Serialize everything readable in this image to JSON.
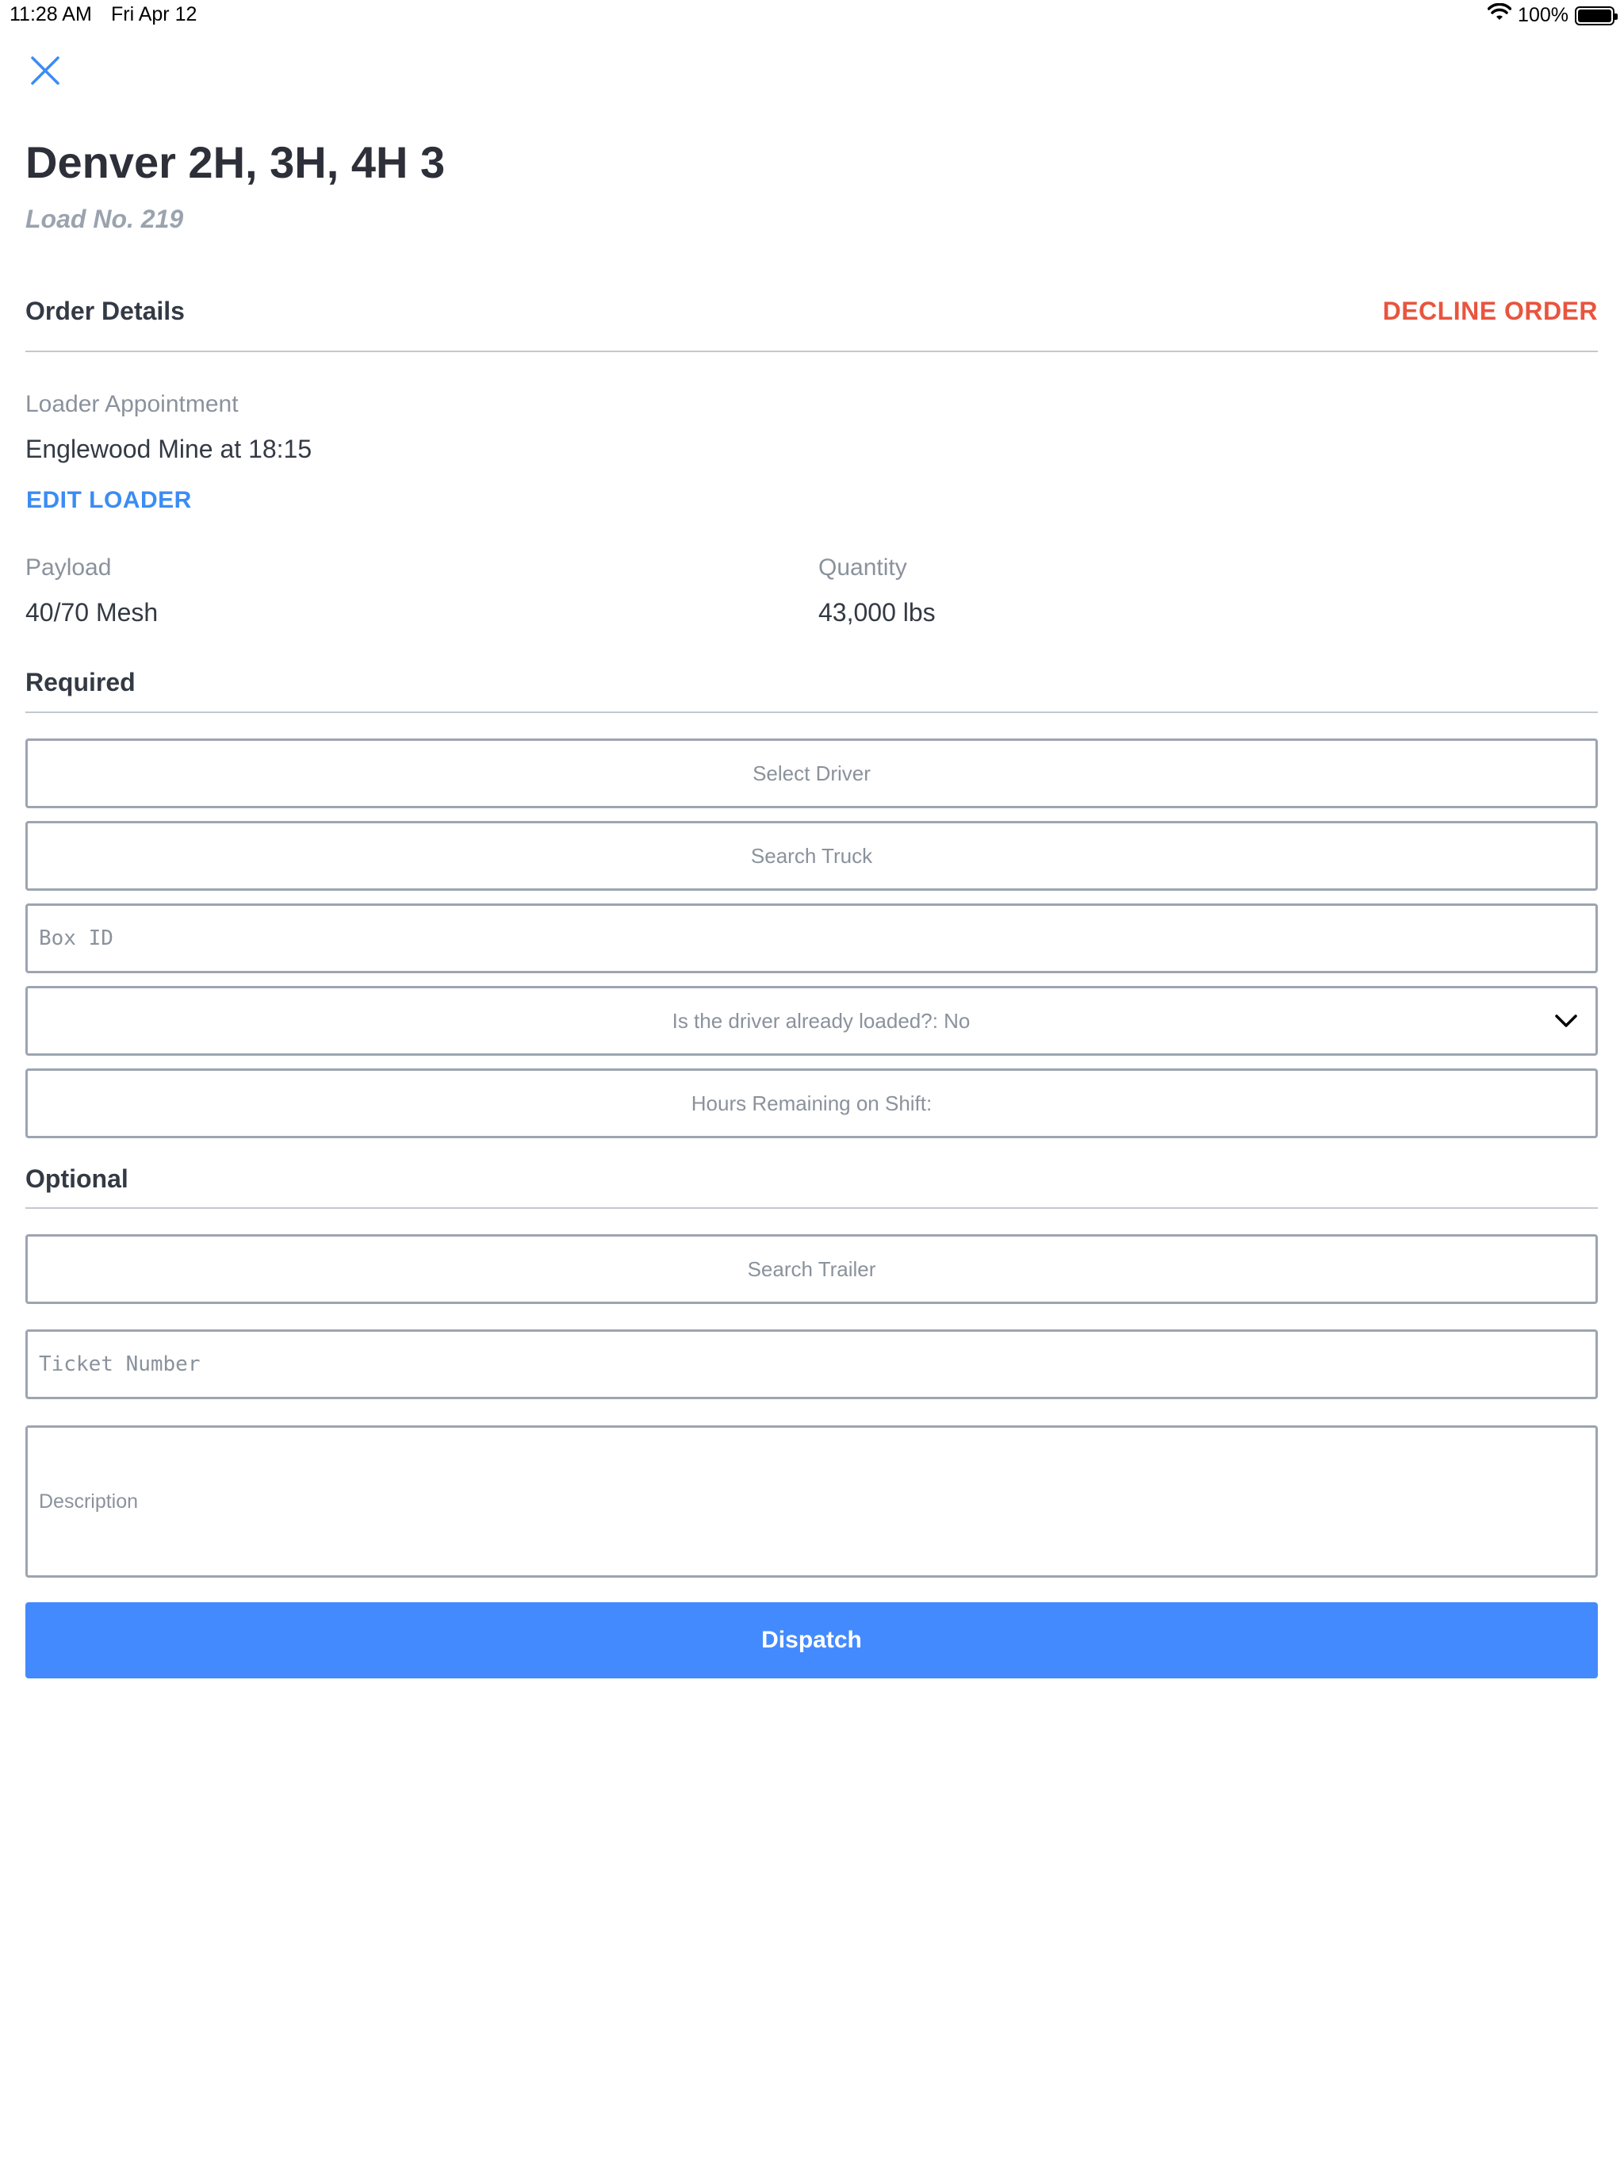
{
  "status_bar": {
    "time": "11:28 AM",
    "date": "Fri Apr 12",
    "battery": "100%",
    "battery_level": 1.0
  },
  "header": {
    "title": "Denver 2H, 3H, 4H 3",
    "subtitle": "Load No. 219",
    "close_icon": "close-icon"
  },
  "order_details": {
    "heading": "Order Details",
    "decline_label": "DECLINE ORDER",
    "loader_label": "Loader Appointment",
    "loader_value": "Englewood Mine at 18:15",
    "edit_loader_label": "EDIT LOADER",
    "payload_label": "Payload",
    "payload_value": "40/70 Mesh",
    "quantity_label": "Quantity",
    "quantity_value": "43,000 lbs"
  },
  "required": {
    "heading": "Required",
    "select_driver": "Select Driver",
    "search_truck": "Search Truck",
    "box_id_placeholder": "Box ID",
    "driver_loaded": "Is the driver already loaded?: No",
    "hours_remaining": "Hours Remaining on Shift:"
  },
  "optional": {
    "heading": "Optional",
    "search_trailer": "Search Trailer",
    "ticket_placeholder": "Ticket Number",
    "description_placeholder": "Description"
  },
  "actions": {
    "dispatch_label": "Dispatch"
  },
  "colors": {
    "accent": "#448aff",
    "link": "#3b8cf4",
    "danger": "#e8553f",
    "border": "#9ca5b0"
  }
}
